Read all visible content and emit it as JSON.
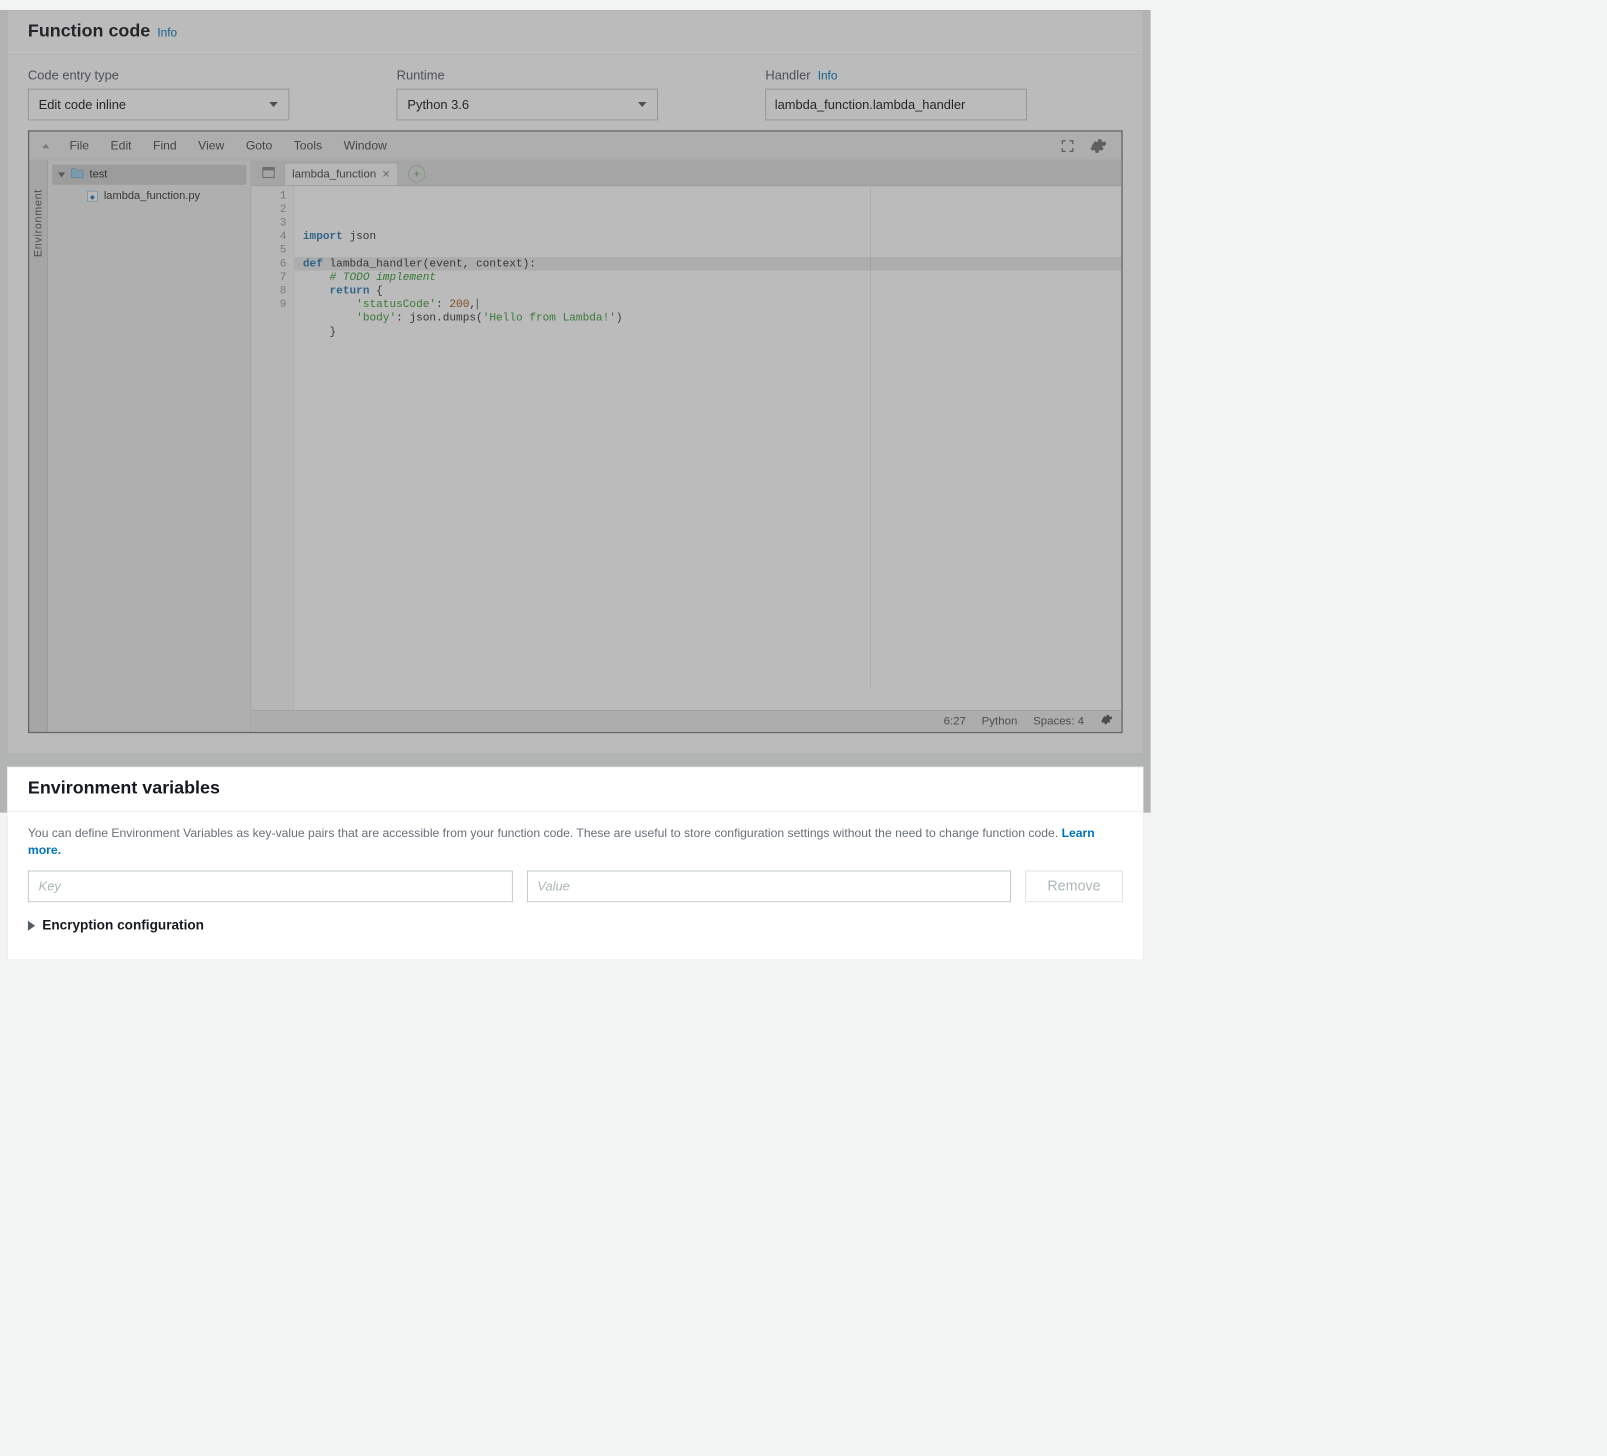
{
  "function_code": {
    "title": "Function code",
    "info": "Info",
    "fields": {
      "code_entry_label": "Code entry type",
      "code_entry_value": "Edit code inline",
      "runtime_label": "Runtime",
      "runtime_value": "Python 3.6",
      "handler_label": "Handler",
      "handler_info": "Info",
      "handler_value": "lambda_function.lambda_handler"
    },
    "ide": {
      "menu": [
        "File",
        "Edit",
        "Find",
        "View",
        "Goto",
        "Tools",
        "Window"
      ],
      "sidebar_label": "Environment",
      "tree": {
        "root": "test",
        "file": "lambda_function.py"
      },
      "tab": {
        "name": "lambda_function"
      },
      "code_lines": [
        "import json",
        "",
        "def lambda_handler(event, context):",
        "    # TODO implement",
        "    return {",
        "        'statusCode': 200,",
        "        'body': json.dumps('Hello from Lambda!')",
        "    }",
        ""
      ],
      "line_count": 9,
      "active_line": 6,
      "status": {
        "pos": "6:27",
        "lang": "Python",
        "spaces": "Spaces: 4"
      }
    }
  },
  "env_vars": {
    "title": "Environment variables",
    "description": "You can define Environment Variables as key-value pairs that are accessible from your function code. These are useful to store configuration settings without the need to change function code. ",
    "learn_more": "Learn more.",
    "key_placeholder": "Key",
    "value_placeholder": "Value",
    "remove_label": "Remove",
    "encryption_label": "Encryption configuration"
  }
}
